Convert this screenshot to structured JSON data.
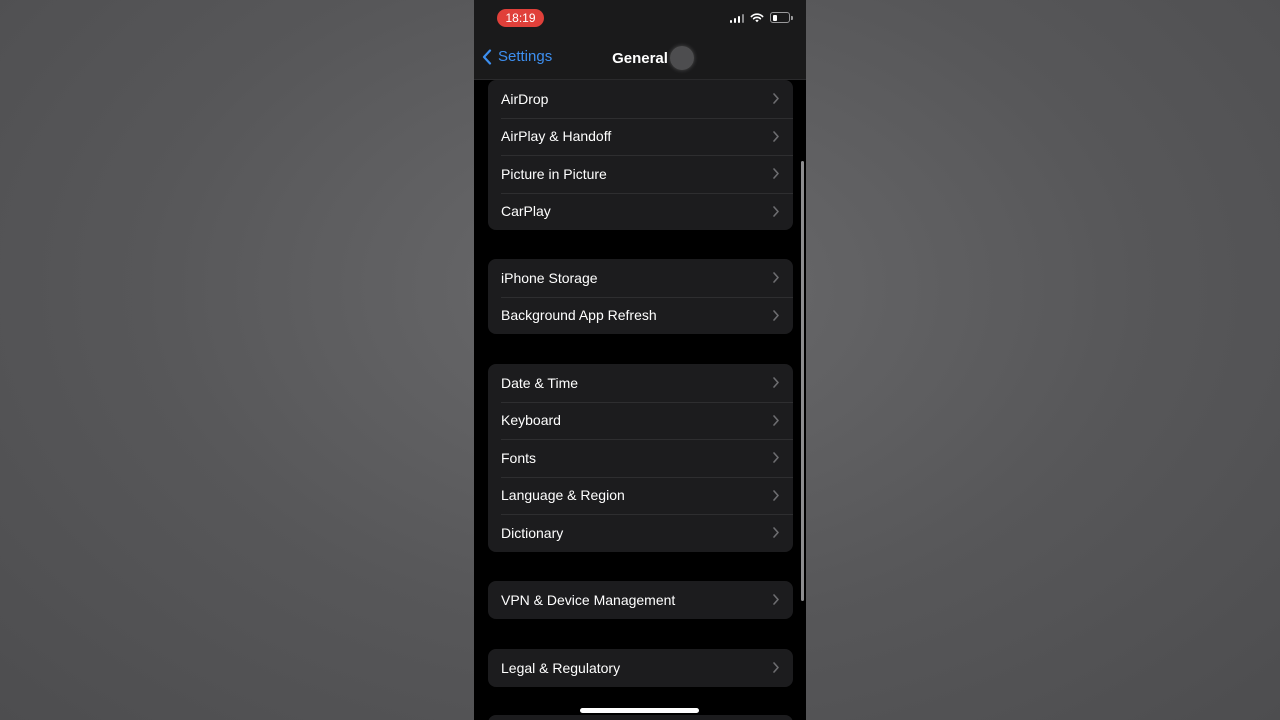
{
  "status_bar": {
    "time": "18:19",
    "icons": [
      "cellular-signal-icon",
      "wifi-icon",
      "battery-icon"
    ],
    "time_pill_color": "#e0403a"
  },
  "nav": {
    "back_label": "Settings",
    "title": "General",
    "accent_color": "#3d8ff0"
  },
  "groups": [
    {
      "items": [
        "AirDrop",
        "AirPlay & Handoff",
        "Picture in Picture",
        "CarPlay"
      ]
    },
    {
      "items": [
        "iPhone Storage",
        "Background App Refresh"
      ]
    },
    {
      "items": [
        "Date & Time",
        "Keyboard",
        "Fonts",
        "Language & Region",
        "Dictionary"
      ]
    },
    {
      "items": [
        "VPN & Device Management"
      ]
    },
    {
      "items": [
        "Legal & Regulatory"
      ]
    }
  ],
  "row_icon": "chevron-right-icon"
}
